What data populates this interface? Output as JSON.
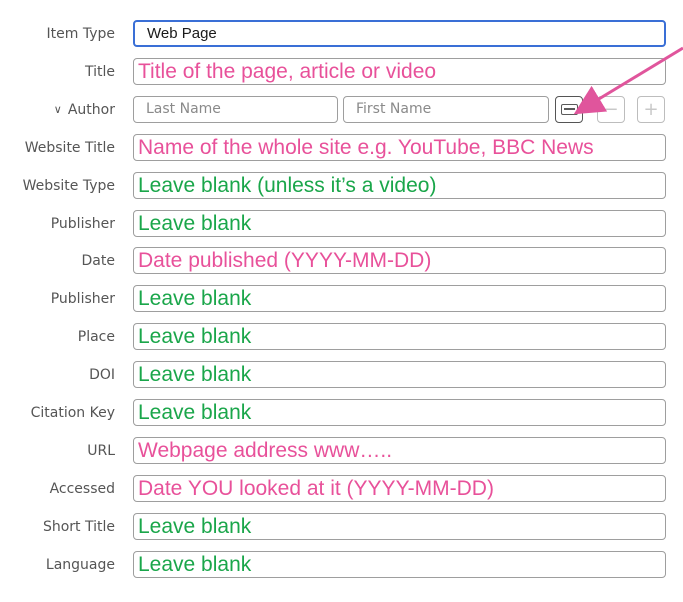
{
  "fields": [
    {
      "key": "item_type",
      "label": "Item Type",
      "value": "Web Page",
      "kind": "value",
      "active": true
    },
    {
      "key": "title",
      "label": "Title",
      "value": "Title of the page, article or video",
      "kind": "note",
      "color": "pink"
    },
    {
      "key": "author",
      "label": "Author",
      "kind": "author"
    },
    {
      "key": "website_title",
      "label": "Website Title",
      "value": "Name of the whole site e.g. YouTube, BBC News",
      "kind": "note",
      "color": "pink"
    },
    {
      "key": "website_type",
      "label": "Website Type",
      "value": "Leave blank (unless it’s a video)",
      "kind": "note",
      "color": "green"
    },
    {
      "key": "publisher1",
      "label": "Publisher",
      "value": "Leave blank",
      "kind": "note",
      "color": "green"
    },
    {
      "key": "date",
      "label": "Date",
      "value": "Date published (YYYY-MM-DD)",
      "kind": "note",
      "color": "pink"
    },
    {
      "key": "publisher2",
      "label": "Publisher",
      "value": "Leave blank",
      "kind": "note",
      "color": "green"
    },
    {
      "key": "place",
      "label": "Place",
      "value": "Leave blank",
      "kind": "note",
      "color": "green"
    },
    {
      "key": "doi",
      "label": "DOI",
      "value": "Leave blank",
      "kind": "note",
      "color": "green"
    },
    {
      "key": "citation_key",
      "label": "Citation Key",
      "value": "Leave blank",
      "kind": "note",
      "color": "green"
    },
    {
      "key": "url",
      "label": "URL",
      "value": "Webpage address www…..",
      "kind": "note",
      "color": "pink"
    },
    {
      "key": "accessed",
      "label": "Accessed",
      "value": "Date YOU looked at it (YYYY-MM-DD)",
      "kind": "note",
      "color": "pink"
    },
    {
      "key": "short_title",
      "label": "Short Title",
      "value": "Leave blank",
      "kind": "note",
      "color": "green"
    },
    {
      "key": "language",
      "label": "Language",
      "value": "Leave blank",
      "kind": "note",
      "color": "green"
    }
  ],
  "author": {
    "last_name_placeholder": "Last Name",
    "first_name_placeholder": "First Name",
    "switch_icon": "card-icon",
    "remove_label": "−",
    "add_label": "+"
  },
  "colors": {
    "pink": "#e8519a",
    "green": "#1aa64a",
    "focus": "#3a6fd6",
    "arrow": "#e0559c"
  }
}
